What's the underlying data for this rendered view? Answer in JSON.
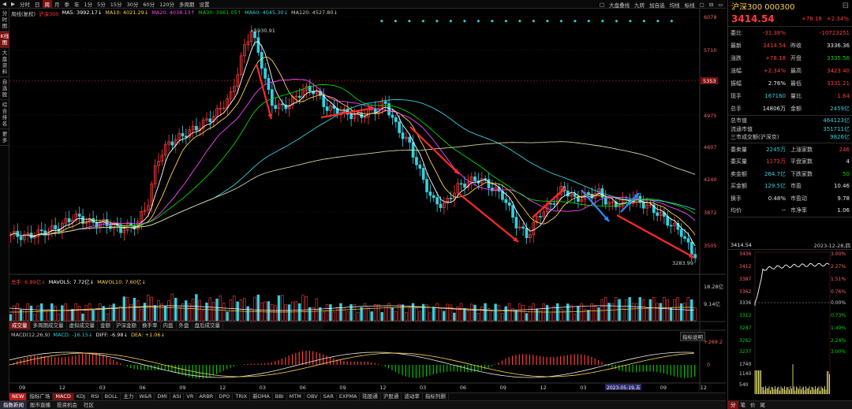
{
  "toolbar": {
    "nav": [
      "◀",
      "▶"
    ],
    "periods": [
      "分时",
      "日",
      "周",
      "月",
      "季",
      "年",
      "1分",
      "5分",
      "15分",
      "30分",
      "60分",
      "120分",
      "多周期",
      "设置"
    ],
    "active_period": "周",
    "right": [
      "□",
      "大盘叠线",
      "九转",
      "加自选",
      "均线",
      "标线",
      "▢",
      "⊟",
      "▭",
      "▣"
    ]
  },
  "left_tabs": [
    "分时图",
    "K线图",
    "大盘资料",
    "自选股",
    "综合排名",
    "更多"
  ],
  "legend": {
    "price": [
      [
        "周线(复权)",
        "#c8c8c8"
      ],
      [
        "沪深300",
        "#ff3b3b"
      ],
      [
        "MA5: 3992.17↓",
        "#ffffff"
      ],
      [
        "MA10: 4021.29↓",
        "#ffd24d"
      ],
      [
        "MA20: 4038.13↑",
        "#ff44ff"
      ],
      [
        "MA30: 3961.05↑",
        "#00d800"
      ],
      [
        "MA60: 4045.30↓",
        "#34d0e0"
      ],
      [
        "MA120: 4527.80↓",
        "#cfcf9f"
      ]
    ],
    "vol": [
      [
        "总手: 6.89亿↓",
        "#ff3b3b"
      ],
      [
        "MAVOL5: 7.72亿↓",
        "#ffffff"
      ],
      [
        "MAVOL10: 7.60亿↓",
        "#ffd24d"
      ]
    ],
    "macd": [
      [
        "MACD(12,26,9)",
        "#c8c8c8"
      ],
      [
        "MACD: -16.15↓",
        "#34d0e0"
      ],
      [
        "DIFF: -6.98↓",
        "#e8e8e8"
      ],
      [
        "DEA: +1.06↓",
        "#ffd24d"
      ]
    ]
  },
  "axis": {
    "price": [
      "6078",
      "5710",
      "5343",
      "4975",
      "4607",
      "4240",
      "3872",
      "3505"
    ],
    "highlight": "5353",
    "vol": [
      "18.28亿",
      "9.14亿"
    ],
    "macd": [
      "+269.2",
      "0"
    ],
    "dates": [
      "09",
      "12",
      "03",
      "06",
      "09",
      "12",
      "03",
      "06",
      "09",
      "12",
      "03",
      "06",
      "09",
      "12",
      "03",
      "06",
      "09",
      "12"
    ],
    "date_badge": "2023-05-19,五"
  },
  "annotations": {
    "high": "5930.91",
    "low": "3283.99",
    "macd_btn": "指标说明"
  },
  "indicator_tabs": [
    "成交量",
    "多周期成交量",
    "虚拟成交量",
    "金额",
    "沪深金额",
    "换手率",
    "内盘",
    "外盘",
    "盘后成交量"
  ],
  "bottom_tabs": [
    "NEW",
    "指标广场",
    "MACD",
    "KDJ",
    "RSI",
    "BOLL",
    "主力",
    "W&R",
    "DMI",
    "ASI",
    "VR",
    "ARBR",
    "DPO",
    "TRIX",
    "新DMA",
    "BBI",
    "MTM",
    "OBV",
    "SAR",
    "EXPMA",
    "陆股通",
    "沪股通",
    "波动率",
    "指标列删"
  ],
  "status_bar": [
    "指数新闻",
    "股市直播",
    "投资机会",
    "社区"
  ],
  "quote": {
    "name": "沪深300 000300",
    "price": "3414.54",
    "change": "+78.18",
    "pct": "+2.34%",
    "rows": [
      [
        "委比",
        "-31.38%",
        "red",
        "",
        "-10723251",
        "red"
      ],
      [
        "最新",
        "3414.54",
        "red",
        "昨收",
        "3336.36",
        "wh"
      ],
      [
        "涨跌",
        "+78.18",
        "red",
        "开盘",
        "3335.56",
        "grn"
      ],
      [
        "涨幅",
        "+2.34%",
        "red",
        "最高",
        "3423.40",
        "red"
      ],
      [
        "振幅",
        "2.76%",
        "wh",
        "最低",
        "3331.21",
        "red"
      ],
      [
        "现手",
        "167160",
        "cy",
        "量比",
        "1.64",
        "red"
      ],
      [
        "总手",
        "14806万",
        "wh",
        "金额",
        "2459亿",
        "cy"
      ]
    ],
    "stats": [
      [
        "总市值",
        "464123亿",
        "cy"
      ],
      [
        "流通市值",
        "351711亿",
        "cy"
      ],
      [
        "三市成交额(沪深京)",
        "9826亿",
        "cy"
      ]
    ],
    "stats2": [
      [
        "委卖量",
        "2245万",
        "cy",
        "上涨家数",
        "246",
        "red"
      ],
      [
        "委买量",
        "1173万",
        "red",
        "平盘家数",
        "4",
        "wh"
      ],
      [
        "卖金额",
        "264.7亿",
        "cy",
        "下跌家数",
        "50",
        "grn"
      ],
      [
        "买金额",
        "129.5亿",
        "cy",
        "市盈",
        "10.46",
        "wh"
      ],
      [
        "换手",
        "0.48%",
        "wh",
        "市盈动",
        "9.78",
        "wh"
      ],
      [
        "均价",
        "--",
        "wh",
        "市净率",
        "1.06",
        "wh"
      ]
    ],
    "mini_head": [
      "3414.54",
      "2023-12-28,四"
    ],
    "mini_left": [
      "3436",
      "3412",
      "3387",
      "3362",
      "3336",
      "3312",
      "3287",
      "3262",
      "3237",
      "1740",
      "1140",
      "540"
    ],
    "mini_right": [
      "3.00%",
      "2.27%",
      "1.51%",
      "0.76%",
      "0.00%",
      "0.73%",
      "1.49%",
      "2.24%",
      "3.00%"
    ],
    "tabs": [
      "分",
      "笔",
      "价",
      "尾"
    ]
  },
  "colors": {
    "up": "#ff3b3b",
    "down": "#34d0e0",
    "ma5": "#ffffff",
    "ma10": "#ffd24d",
    "ma20": "#ff44ff",
    "ma30": "#00d800",
    "ma60": "#34d0e0",
    "ma120": "#cfcf9f"
  }
}
